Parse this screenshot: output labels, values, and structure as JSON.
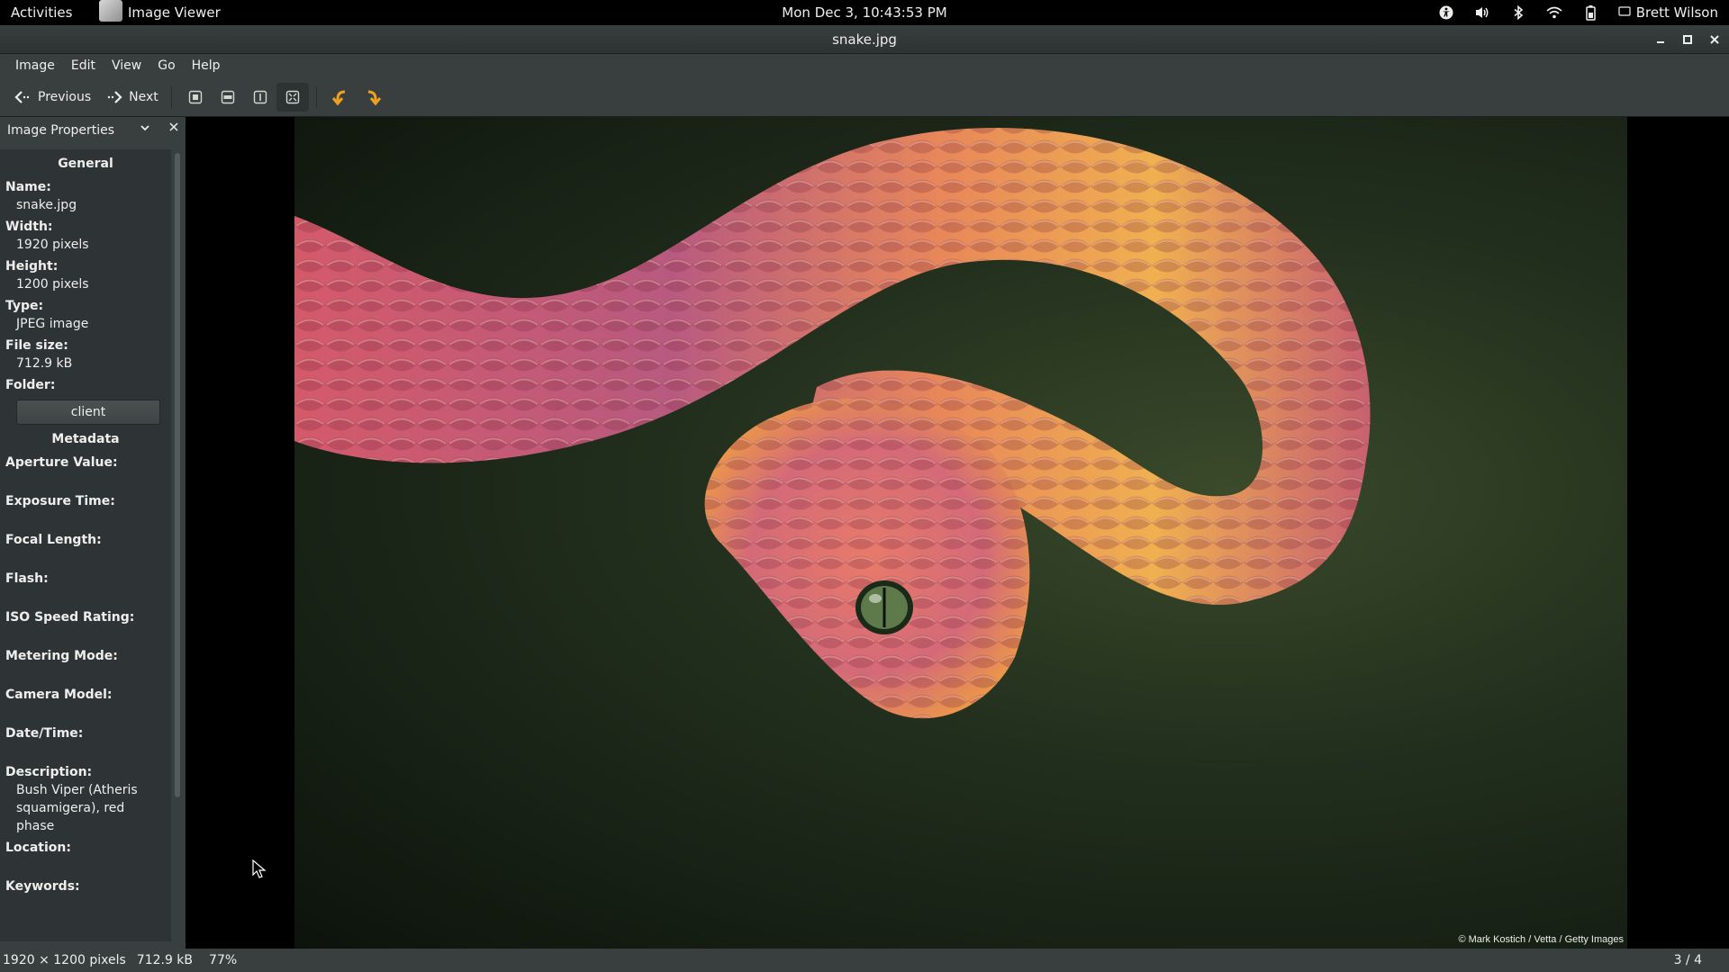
{
  "topbar": {
    "activities": "Activities",
    "app_name": "Image Viewer",
    "clock": "Mon Dec  3, 10:43:53 PM",
    "user": "Brett Wilson",
    "tray_icons": [
      "accessibility-icon",
      "volume-icon",
      "bluetooth-icon",
      "wifi-icon",
      "battery-icon"
    ]
  },
  "window": {
    "title": "snake.jpg"
  },
  "menubar": {
    "items": [
      "Image",
      "Edit",
      "View",
      "Go",
      "Help"
    ]
  },
  "toolbar": {
    "previous_label": "Previous",
    "next_label": "Next",
    "icons": [
      "best-fit-icon",
      "fit-width-icon",
      "zoom-normal-icon",
      "zoom-fit-icon",
      "rotate-left-icon",
      "rotate-right-icon"
    ]
  },
  "sidebar": {
    "header": "Image Properties",
    "general_title": "General",
    "name_label": "Name:",
    "name_value": "snake.jpg",
    "width_label": "Width:",
    "width_value": "1920 pixels",
    "height_label": "Height:",
    "height_value": "1200 pixels",
    "type_label": "Type:",
    "type_value": "JPEG image",
    "filesize_label": "File size:",
    "filesize_value": "712.9 kB",
    "folder_label": "Folder:",
    "folder_button": "client",
    "metadata_title": "Metadata",
    "aperture_label": "Aperture Value:",
    "exposure_label": "Exposure Time:",
    "focal_label": "Focal Length:",
    "flash_label": "Flash:",
    "iso_label": "ISO Speed Rating:",
    "metering_label": "Metering Mode:",
    "camera_label": "Camera Model:",
    "datetime_label": "Date/Time:",
    "description_label": "Description:",
    "description_value": "Bush Viper (Atheris squamigera), red phase",
    "location_label": "Location:",
    "keywords_label": "Keywords:"
  },
  "viewer": {
    "credit": "© Mark Kostich / Vetta / Getty Images"
  },
  "statusbar": {
    "dimensions": "1920 × 1200 pixels",
    "size": "712.9 kB",
    "zoom": "77%",
    "position": "3 / 4"
  },
  "colors": {
    "panel": "#393f3f",
    "sidebar_bg": "#2e3436",
    "rotate_accent": "#f0a020"
  }
}
